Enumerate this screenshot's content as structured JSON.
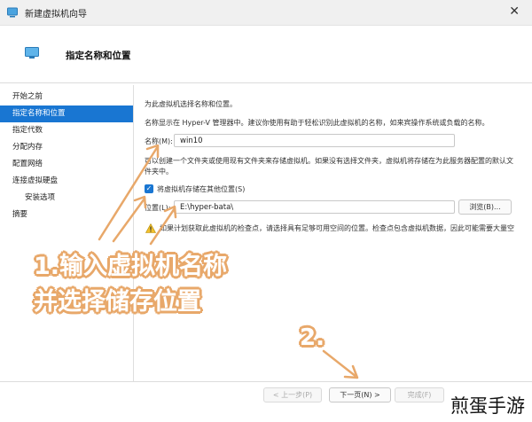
{
  "window": {
    "title": "新建虚拟机向导",
    "close_glyph": "✕"
  },
  "header": {
    "title": "指定名称和位置"
  },
  "nav": {
    "items": [
      {
        "label": "开始之前",
        "active": false,
        "sub": false
      },
      {
        "label": "指定名称和位置",
        "active": true,
        "sub": false
      },
      {
        "label": "指定代数",
        "active": false,
        "sub": false
      },
      {
        "label": "分配内存",
        "active": false,
        "sub": false
      },
      {
        "label": "配置网络",
        "active": false,
        "sub": false
      },
      {
        "label": "连接虚拟硬盘",
        "active": false,
        "sub": false
      },
      {
        "label": "安装选项",
        "active": false,
        "sub": true
      },
      {
        "label": "摘要",
        "active": false,
        "sub": false
      }
    ]
  },
  "content": {
    "intro": "为此虚拟机选择名称和位置。",
    "name_hint": "名称显示在 Hyper-V 管理器中。建议你使用有助于轻松识别此虚拟机的名称，如来宾操作系统或负载的名称。",
    "name_label": "名称(M):",
    "name_value": "win10",
    "folder_hint_1": "可以创建一个文件夹或使用现有文件夹来存储虚拟机。如果没有选择文件夹，虚拟机将存储在为此服务器配置的默认文",
    "folder_hint_2": "件夹中。",
    "store_checkbox_label": "将虚拟机存储在其他位置(S)",
    "store_checked": true,
    "location_label": "位置(L):",
    "location_value": "E:\\hyper-bata\\",
    "browse_label": "浏览(B)...",
    "warning_text": "如果计划获取此虚拟机的检查点，请选择具有足够可用空间的位置。检查点包含虚拟机数据，因此可能需要大量空"
  },
  "footer": {
    "prev_label": "< 上一步(P)",
    "next_label": "下一页(N) >",
    "finish_label": "完成(F)"
  },
  "annotations": {
    "step1_line1": "1.输入虚拟机名称",
    "step1_line2": "并选择储存位置",
    "step2": "2."
  },
  "watermark": "煎蛋手游",
  "colors": {
    "accent": "#1976d2",
    "annotation_orange": "#e8a86a"
  }
}
